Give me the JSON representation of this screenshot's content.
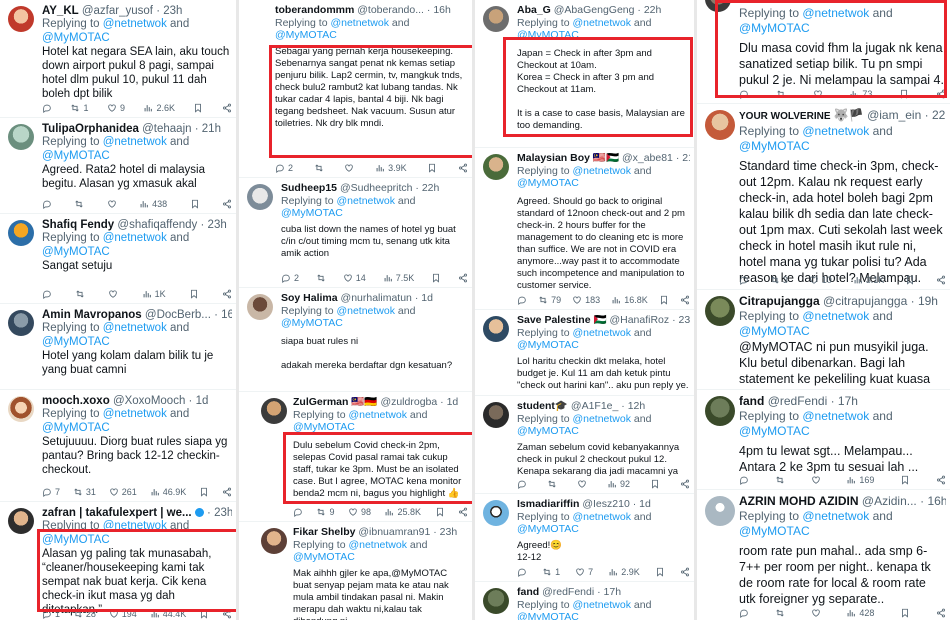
{
  "mentions": {
    "a": "@netnetwok",
    "b": "@MyMOTAC",
    "sep": " and ",
    "prefix": "Replying to "
  },
  "colors": {
    "highlight": "#e8232b",
    "link": "#1d9bf0",
    "muted": "#536471"
  },
  "icons": [
    "reply-icon",
    "retweet-icon",
    "like-icon",
    "views-icon",
    "bookmark-icon",
    "share-icon"
  ],
  "columns": [
    {
      "tweets": [
        {
          "name": "AY_KL",
          "handle": "@azfar_yusof",
          "time": "23h",
          "text": "Hotel kat negara SEA lain, aku touch down airport pukul 8 pagi, sampai hotel dlm pukul 10, pukul 11 dah boleh dpt bilik",
          "reply": "",
          "retweets": "1",
          "likes": "9",
          "views": "2.6K"
        },
        {
          "name": "TulipaOrphanidea",
          "handle": "@tehaajn",
          "time": "21h",
          "text": "Agreed. Rata2 hotel di malaysia begitu. Alasan yg xmasuk akal",
          "reply": "",
          "retweets": "",
          "likes": "",
          "views": "438"
        },
        {
          "name": "Shafiq Fendy",
          "handle": "@shafiqaffendy",
          "time": "23h",
          "text": "Sangat setuju",
          "reply": "",
          "retweets": "",
          "likes": "",
          "views": "1K"
        },
        {
          "name": "Amin Mavropanos",
          "handle": "@DocBerb...",
          "time": "16h",
          "text": "Hotel yang kolam dalam bilik tu je yang buat camni",
          "reply": "",
          "retweets": "",
          "likes": "",
          "views": ""
        },
        {
          "name": "mooch.xoxo",
          "handle": "@XoxoMooch",
          "time": "1d",
          "text": "Setujuuuu. Diorg buat rules siapa yg pantau? Bring back 12-12 checkin-checkout.",
          "reply": "7",
          "retweets": "31",
          "likes": "261",
          "views": "46.9K"
        },
        {
          "name": "zafran | takafulexpert | we...",
          "handle": "",
          "time": "23h",
          "text": "Alasan yg paling tak munasabah, “cleaner/housekeeping kami tak sempat nak buat kerja. Cik kena check-in ikut masa yg dah ditetapkan.”",
          "reply": "1",
          "retweets": "28",
          "likes": "194",
          "views": "44.4K"
        }
      ]
    },
    {
      "tweets": [
        {
          "name": "toberandommm",
          "handle": "@toberando...",
          "time": "16h",
          "text": "Sebagai yang pernah kerja housekeeping. Sebenarnya sangat penat nk kemas setiap penjuru bilik. Lap2 cermin, tv, mangkuk tnds, check bulu2 rambut2 kat lubang tandas. Nk tukar cadar 4 lapis, bantal 4 biji. Nk bagi tegang bedsheet. Nak vacuum. Susun atur toiletries. Nk dry blk mndi.",
          "reply": "2",
          "retweets": "",
          "likes": "",
          "views": "3.9K"
        },
        {
          "name": "Sudheep15",
          "handle": "@Sudheepritch",
          "time": "22h",
          "text": "cuba list down the names of hotel yg buat c/in c/out timing mcm tu, senang utk kita amik action",
          "reply": "2",
          "retweets": "",
          "likes": "14",
          "views": "7.5K"
        },
        {
          "name": "Soy Halima",
          "handle": "@nurhalimatun",
          "time": "1d",
          "text": "siapa buat rules ni\n\nadakah mereka berdaftar dgn kesatuan?",
          "reply": "",
          "retweets": "",
          "likes": "",
          "views": ""
        },
        {
          "name": "ZulGerman",
          "handle": "@zuldrogba",
          "time": "1d",
          "text": "Dulu sebelum Covid check-in 2pm, selepas Covid pasal ramai tak cukup staff, tukar ke 3pm. Must be an isolated case. But I agree, MOTAC kena monitor benda2 mcm ni, bagus you highlight 👍",
          "reply": "",
          "retweets": "9",
          "likes": "98",
          "views": "25.8K"
        },
        {
          "name": "Fikar Shelby",
          "handle": "@ibnuamran91",
          "time": "23h",
          "text": "Mak aihhh gjler ke apa,@MyMOTAC buat senyap pejam mata ke atau nak mula ambil tindakan pasal ni. Makin merapu dah waktu ni,kalau tak dibendung ni",
          "reply": "",
          "retweets": "",
          "likes": "",
          "views": ""
        }
      ]
    },
    {
      "tweets": [
        {
          "name": "Aba_G",
          "handle": "@AbaGengGeng",
          "time": "22h",
          "text": "Japan = Check in after 3pm and Checkout at 10am.\nKorea = Check in after 3 pm and Checkout at 11am.\n\nIt is a case to case basis, Malaysian are too demanding.",
          "reply": "",
          "retweets": "",
          "likes": "",
          "views": ""
        },
        {
          "name": "Malaysian Boy",
          "handle": "@x_abe81",
          "time": "21h",
          "text": "Agreed. Should go back to original standard of 12noon check-out and 2 pm check-in. 2 hours buffer for the management to do cleaning etc is more than suffice. We are not in COVID era anymore...way past it to accommodate such incompetence and manipulation to customer service.",
          "reply": "",
          "retweets": "79",
          "likes": "183",
          "views": "16.8K"
        },
        {
          "name": "Save Palestine",
          "handle": "@HanafiRoz",
          "time": "23h",
          "text": "Lol haritu checkin dkt melaka, hotel budget je. Kul 11 am dah ketuk pintu \"check out harini kan\".. aku pun reply ye.",
          "reply": "",
          "retweets": "",
          "likes": "",
          "views": ""
        },
        {
          "name": "student🎓",
          "handle": "@A1F1e_",
          "time": "12h",
          "text": "Zaman sebelum covid kebanyakannya check in pukul 2 checkout pukul 12. Kenapa sekarang dia jadi macamni ya",
          "reply": "",
          "retweets": "",
          "likes": "",
          "views": "92"
        },
        {
          "name": "Ismadiariffin",
          "handle": "@Iesz210",
          "time": "1d",
          "text": "Agreed!😊\n12-12",
          "reply": "",
          "retweets": "1",
          "likes": "7",
          "views": "2.9K"
        },
        {
          "name": "fand",
          "handle": "@redFendi",
          "time": "17h",
          "text": "",
          "reply": "",
          "retweets": "",
          "likes": "",
          "views": ""
        }
      ]
    },
    {
      "tweets": [
        {
          "name": "",
          "handle": "",
          "time": "",
          "text": "Dlu masa covid fhm la jugak nk kena sanatized setiap bilik. Tu pn smpi pukul 2 je. Ni melampau la sampai 4.",
          "reply": "",
          "retweets": "",
          "likes": "",
          "views": "73"
        },
        {
          "name": "YOUR WOLVERINE",
          "handle": "@iam_ein",
          "time": "22h",
          "text": "Standard time check-in 3pm, check-out 12pm. Kalau nk request early check-in, ada hotel boleh bagi 2pm kalau bilik dh sedia dan late check-out 1pm max. Cuti sekolah last week check in hotel masih ikut rule ni, hotel mana yg tukar polisi tu? Ada reason ke dari hotel? Melampau.",
          "reply": "",
          "retweets": "3",
          "likes": "10",
          "views": "3.1K"
        },
        {
          "name": "Citrapujangga",
          "handle": "@citrapujangga",
          "time": "19h",
          "text": "@MyMOTAC ni pun musyikil juga. Klu betul dibenarkan. Bagi lah statement ke pekeliling kuat kuasa ke.",
          "reply": "",
          "retweets": "",
          "likes": "",
          "views": ""
        },
        {
          "name": "fand",
          "handle": "@redFendi",
          "time": "17h",
          "text": "4pm tu lewat sgt... Melampau... Antara 2 ke 3pm tu sesuai lah ...",
          "reply": "",
          "retweets": "",
          "likes": "",
          "views": "169"
        },
        {
          "name": "AZRIN MOHD AZIDIN",
          "handle": "@Azidin...",
          "time": "16h",
          "text": "room rate pun mahal.. ada smp 6-7++ per room per night.. kenapa tk de room rate for local & room rate utk foreigner yg separate..",
          "reply": "",
          "retweets": "",
          "likes": "",
          "views": "428"
        }
      ]
    }
  ]
}
